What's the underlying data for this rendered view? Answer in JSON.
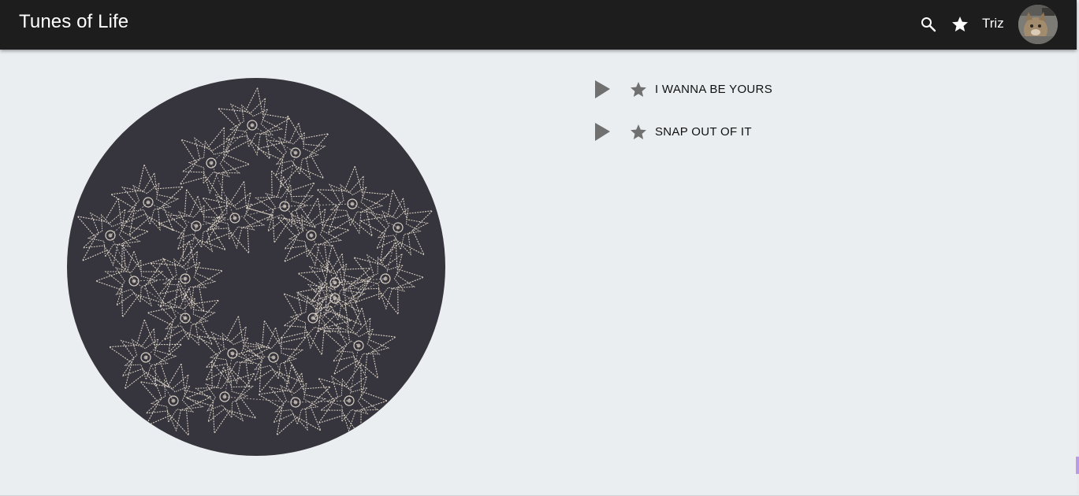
{
  "app": {
    "title": "Tunes of Life",
    "user_name": "Triz"
  },
  "header": {
    "icons": [
      "search-icon",
      "star-icon"
    ]
  },
  "songs": [
    {
      "title": "I WANNA BE YOURS",
      "icon_play": "play-icon",
      "icon_fav": "star-icon"
    },
    {
      "title": "SNAP OUT OF IT",
      "icon_play": "play-icon",
      "icon_fav": "star-icon"
    }
  ],
  "colors": {
    "appbar": "#1d1d1d",
    "background": "#eaeef1",
    "disc": "#36343c",
    "pattern": "#d8d0c4",
    "icon_gray": "#707070"
  }
}
